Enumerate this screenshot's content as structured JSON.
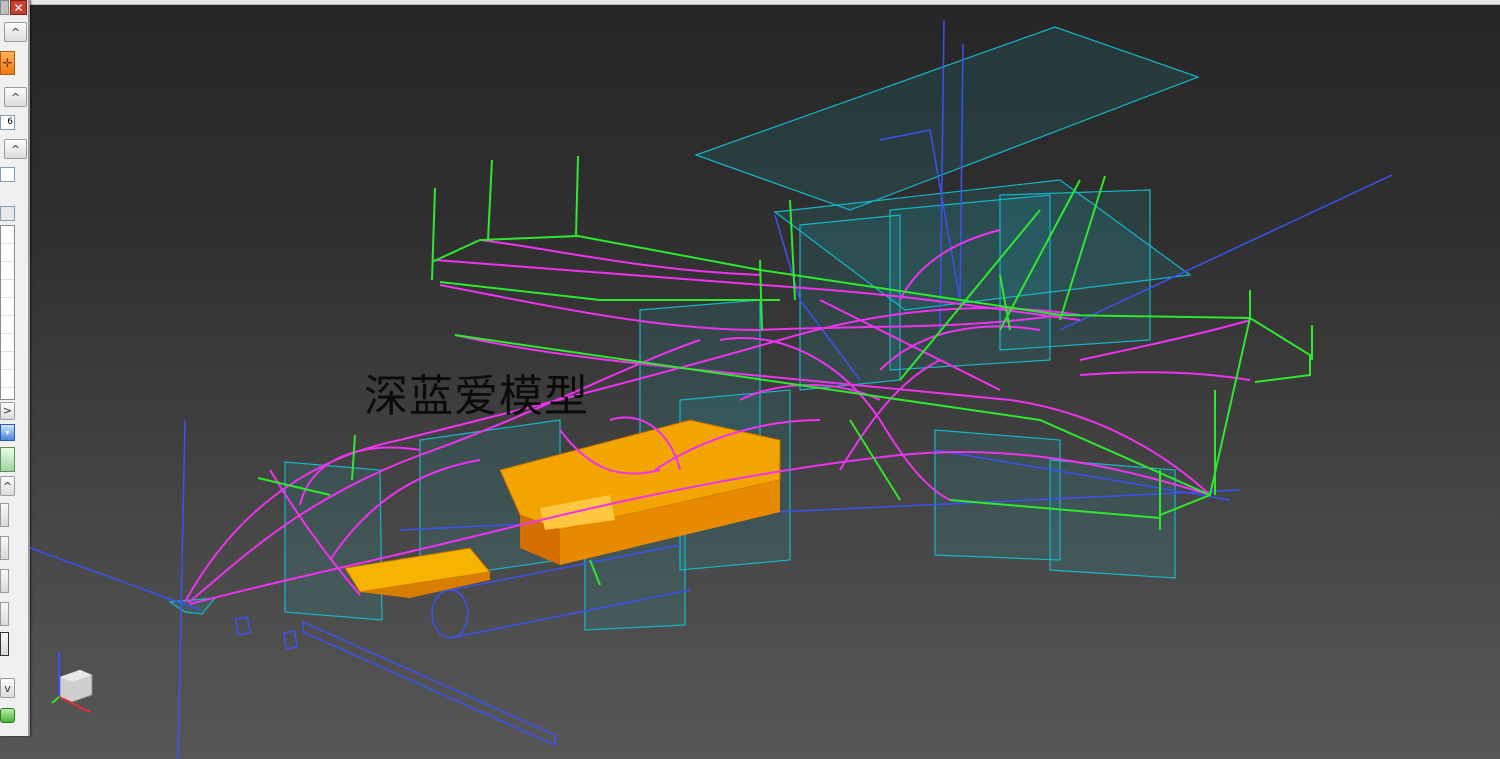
{
  "window": {
    "close_glyph": "✕"
  },
  "left_panel": {
    "field_value": "6",
    "scroll_up_glyph": "^",
    "scroll_down_glyph": "v",
    "scroll_right_glyph": ">",
    "orange_tool_icon": "crosshair-icon",
    "list_rows": 10,
    "stack_buttons": 5
  },
  "viewport": {
    "watermark": "深蓝爱模型",
    "background_top": "#262626",
    "background_bottom": "#575757",
    "colors": {
      "sketch_magenta": "#ee33ee",
      "curve_green": "#2ee82e",
      "axis_blue": "#3b52f0",
      "plane_cyan": "#16b6c8",
      "body_orange": "#f2a400"
    },
    "triad_icon": "view-orientation-cube-icon"
  }
}
